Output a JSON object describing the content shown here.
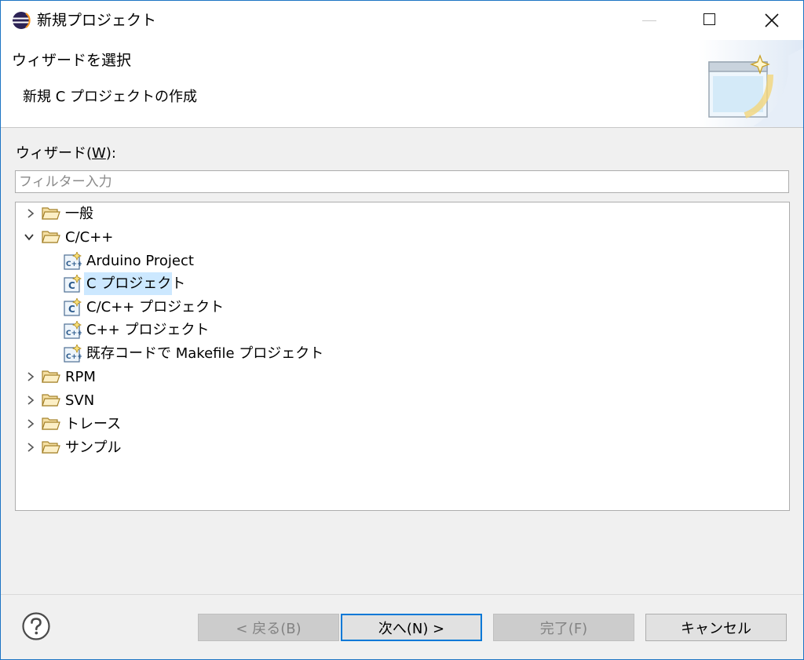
{
  "window": {
    "title": "新規プロジェクト"
  },
  "banner": {
    "title": "ウィザードを選択",
    "description": "新規 C プロジェクトの作成"
  },
  "wizard": {
    "label_prefix": "ウィザード(",
    "label_mnemonic": "W",
    "label_suffix": "):",
    "filter_placeholder": "フィルター入力",
    "filter_value": ""
  },
  "tree": {
    "items": [
      {
        "label": "一般",
        "expanded": false
      },
      {
        "label": "C/C++",
        "expanded": true
      },
      {
        "label": "Arduino Project",
        "icon": "cpp-project-icon"
      },
      {
        "label": "C プロジェクト",
        "icon": "c-project-icon",
        "selected": true
      },
      {
        "label": "C/C++ プロジェクト",
        "icon": "c-project-icon"
      },
      {
        "label": "C++ プロジェクト",
        "icon": "cpp-project-icon"
      },
      {
        "label": "既存コードで Makefile プロジェクト",
        "icon": "cpp-project-icon"
      },
      {
        "label": "RPM",
        "expanded": false
      },
      {
        "label": "SVN",
        "expanded": false
      },
      {
        "label": "トレース",
        "expanded": false
      },
      {
        "label": "サンプル",
        "expanded": false
      }
    ]
  },
  "buttons": {
    "back": "< 戻る(B)",
    "next": "次へ(N) >",
    "finish": "完了(F)",
    "cancel": "キャンセル"
  },
  "colors": {
    "selection": "#cce8ff",
    "accent": "#0078d7",
    "folder": "#dcb864"
  }
}
